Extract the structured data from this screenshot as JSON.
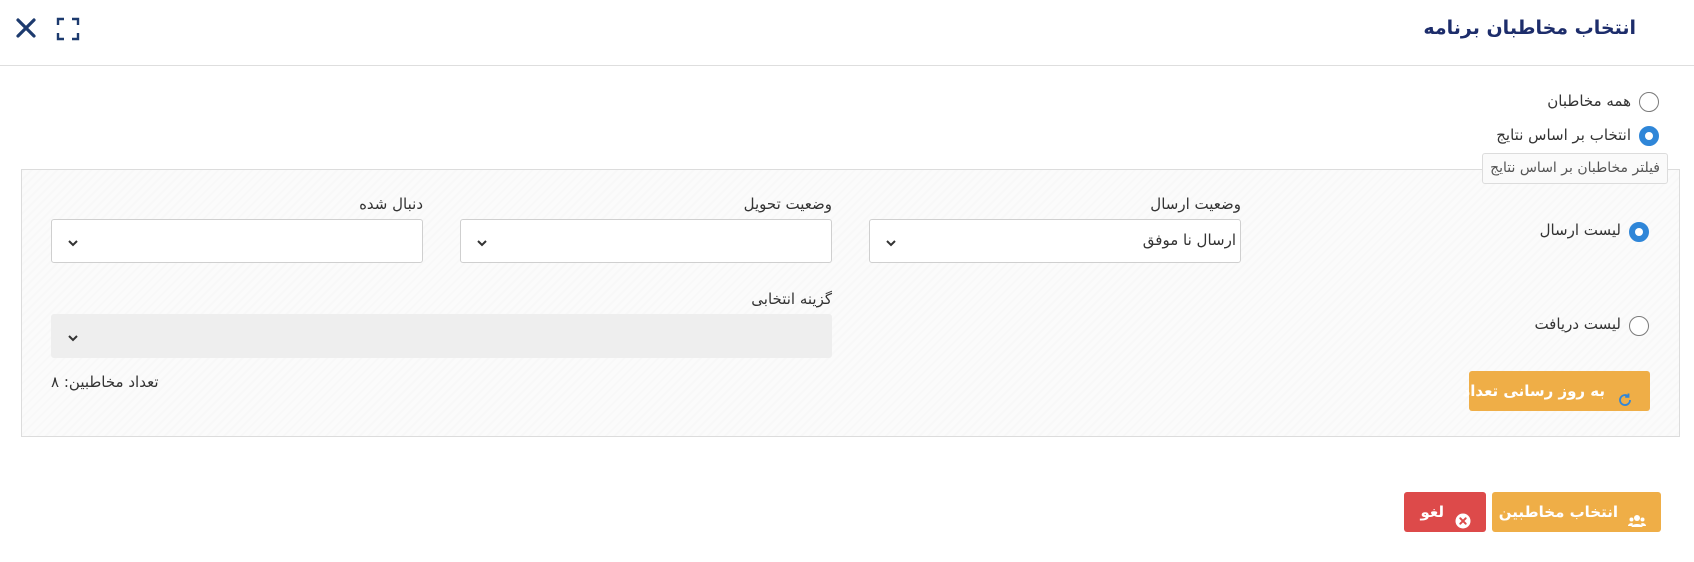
{
  "window": {
    "title": "انتخاب مخاطبان برنامه",
    "close_icon": "close-icon",
    "expand_icon": "fullscreen-icon"
  },
  "audience": {
    "all_label": "همه مخاطبان",
    "all_selected": false,
    "by_results_label": "انتخاب بر اساس نتایج",
    "by_results_selected": true
  },
  "filter": {
    "legend": "فیلتر مخاطبان بر اساس نتایج",
    "send_list_label": "لیست ارسال",
    "send_list_selected": true,
    "receive_list_label": "لیست دریافت",
    "receive_list_selected": false,
    "send_status": {
      "label": "وضعیت ارسال",
      "value": "ارسال نا موفق"
    },
    "delivery_status": {
      "label": "وضعیت تحویل",
      "value": ""
    },
    "followed": {
      "label": "دنبال شده",
      "value": ""
    },
    "selected_option": {
      "label": "گزینه انتخابی",
      "value": ""
    },
    "update_count_label": "به روز رسانی تعداد",
    "update_icon": "refresh-icon",
    "contacts_count_label": "تعداد مخاطبین:",
    "contacts_count": "۸"
  },
  "footer": {
    "select_contacts_label": "انتخاب مخاطبین",
    "select_contacts_icon": "users-icon",
    "cancel_label": "لغو",
    "cancel_icon": "cancel-circle-icon"
  },
  "colors": {
    "title": "#1d2d6b",
    "radio_active": "#2f86d8",
    "primary_button": "#efae47",
    "danger_button": "#dd4a4a"
  }
}
